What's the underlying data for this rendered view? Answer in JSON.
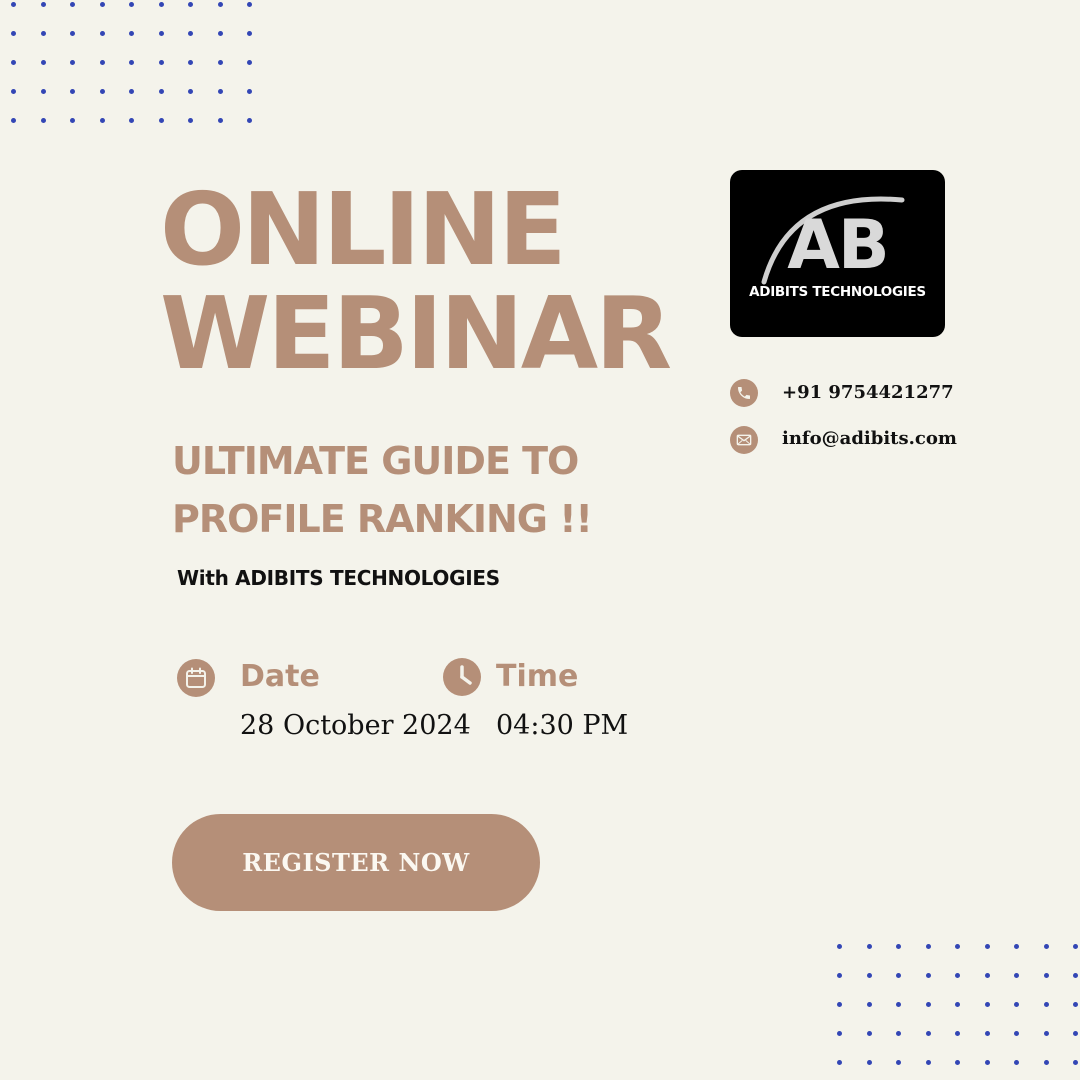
{
  "headline": {
    "line1": "ONLINE",
    "line2": "WEBINAR"
  },
  "subtitle": {
    "line1": "ULTIMATE GUIDE TO",
    "line2": "PROFILE RANKING !!"
  },
  "host_line": "With ADIBITS TECHNOLOGIES",
  "date": {
    "label": "Date",
    "value": "28 October 2024",
    "icon": "calendar-icon"
  },
  "time": {
    "label": "Time",
    "value": "04:30 PM",
    "icon": "clock-icon"
  },
  "cta": {
    "label": "REGISTER NOW"
  },
  "logo": {
    "letters": "AB",
    "name": "ADIBITS TECHNOLOGIES"
  },
  "contact": {
    "phone": {
      "text": "+91 9754421277",
      "icon": "phone-icon"
    },
    "email": {
      "text": "info@adibits.com",
      "icon": "mail-icon"
    }
  },
  "colors": {
    "background": "#f4f3eb",
    "accent": "#b58f78",
    "dots": "#3346b5",
    "logo_bg": "#000000"
  }
}
